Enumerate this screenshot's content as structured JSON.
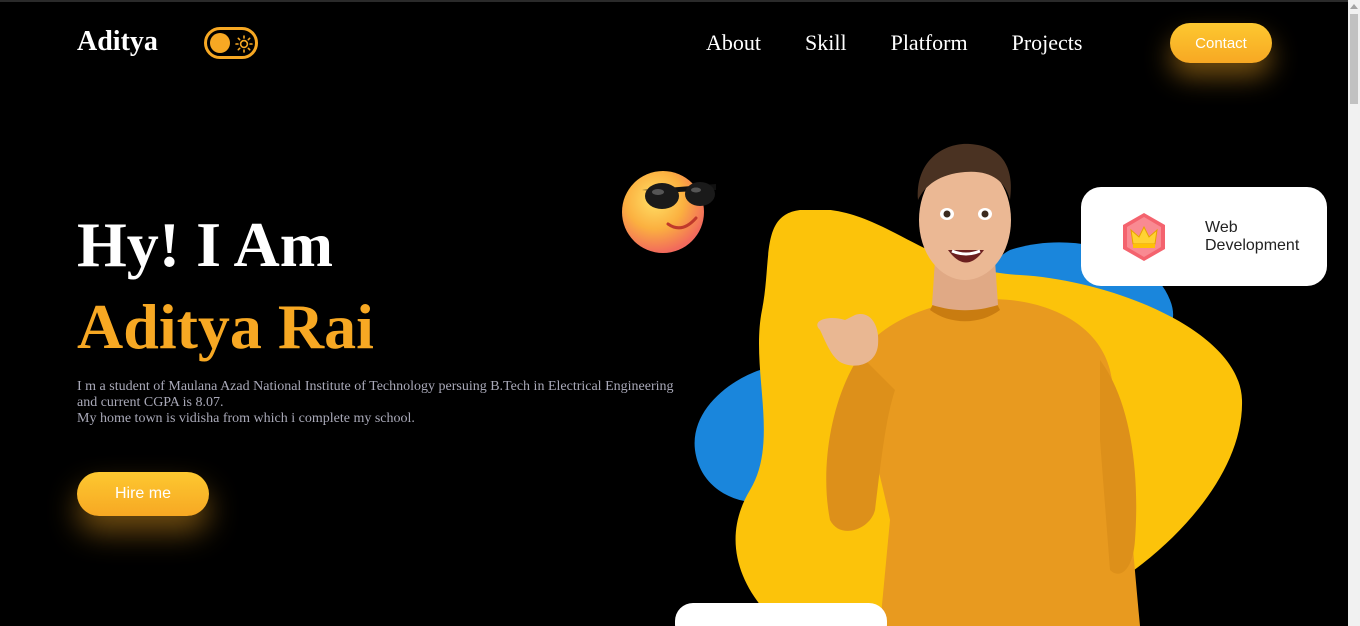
{
  "header": {
    "logo": "Aditya",
    "nav": [
      "About",
      "Skill",
      "Platform",
      "Projects"
    ],
    "contact_label": "Contact"
  },
  "hero": {
    "greeting": "Hy! I Am",
    "name": "Aditya Rai",
    "description_lines": [
      "I m a student of Maulana Azad National Institute of Technology persuing B.Tech in Electrical Engineering",
      "and current CGPA is 8.07.",
      "My home town is vidisha from which i complete my school."
    ],
    "hire_label": "Hire me"
  },
  "cards": {
    "web": "Web Development"
  },
  "colors": {
    "accent": "#f7a823",
    "background": "#000000",
    "blob_yellow": "#fcc30a",
    "blob_blue": "#1a86dc"
  },
  "icons": [
    "sun-icon",
    "crown-icon",
    "sunglasses-emoji"
  ]
}
